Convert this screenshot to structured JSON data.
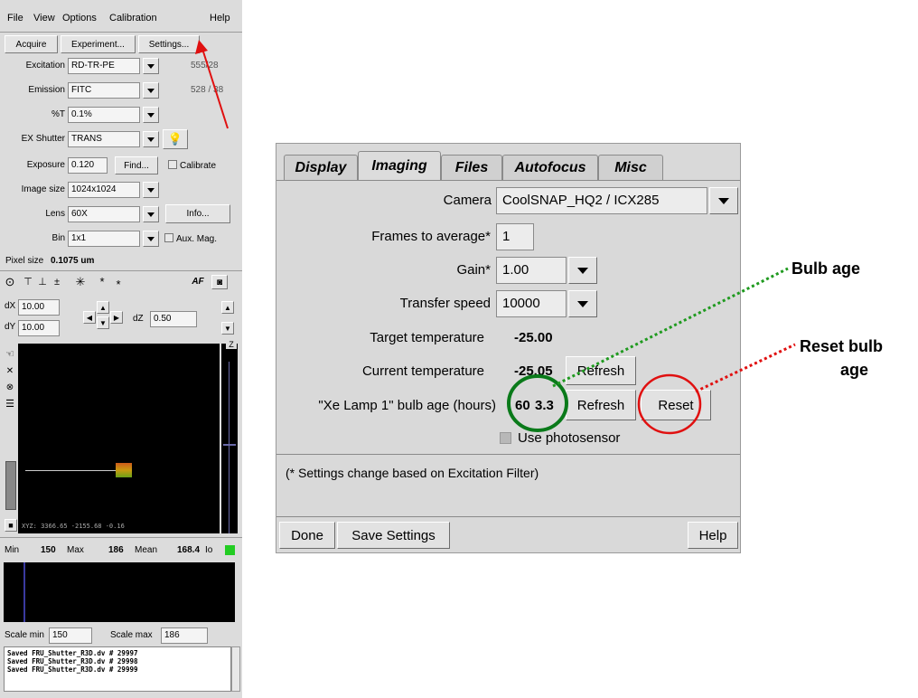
{
  "main_window": {
    "menu": [
      "File",
      "View",
      "Options",
      "Calibration",
      "Help"
    ],
    "toolbar": {
      "acquire": "Acquire",
      "experiment": "Experiment...",
      "settings": "Settings..."
    },
    "excitation": {
      "label": "Excitation",
      "value": "RD-TR-PE",
      "wavelength": "555/28"
    },
    "emission": {
      "label": "Emission",
      "value": "FITC",
      "wavelength": "528 / 38"
    },
    "transmission": {
      "label": "%T",
      "value": "0.1%"
    },
    "ex_shutter": {
      "label": "EX Shutter",
      "value": "TRANS"
    },
    "exposure": {
      "label": "Exposure",
      "value": "0.120",
      "find": "Find...",
      "calibrate": "Calibrate"
    },
    "image_size": {
      "label": "Image size",
      "value": "1024x1024"
    },
    "lens": {
      "label": "Lens",
      "value": "60X",
      "info": "Info..."
    },
    "bin": {
      "label": "Bin",
      "value": "1x1",
      "aux_mag": "Aux. Mag."
    },
    "pixel_size": {
      "label": "Pixel size",
      "value": "0.1075 um"
    },
    "af": "AF",
    "dx": {
      "label": "dX",
      "value": "10.00"
    },
    "dy": {
      "label": "dY",
      "value": "10.00"
    },
    "dz": {
      "label": "dZ",
      "value": "0.50"
    },
    "z_label": "Z",
    "xyz_readout": "XYZ: 3366.65 -2155.68 -0.16",
    "stats": {
      "min_label": "Min",
      "min": "150",
      "max_label": "Max",
      "max": "186",
      "mean_label": "Mean",
      "mean": "168.4",
      "suffix": "Io"
    },
    "scale": {
      "min_label": "Scale min",
      "min": "150",
      "max_label": "Scale max",
      "max": "186"
    },
    "log": [
      "Saved FRU_Shutter_R3D.dv # 29997",
      "Saved FRU_Shutter_R3D.dv # 29998",
      "Saved FRU_Shutter_R3D.dv # 29999"
    ]
  },
  "settings_dialog": {
    "tabs": [
      "Display",
      "Imaging",
      "Files",
      "Autofocus",
      "Misc"
    ],
    "active_tab": "Imaging",
    "camera": {
      "label": "Camera",
      "value": "CoolSNAP_HQ2 / ICX285"
    },
    "frames": {
      "label": "Frames to average*",
      "value": "1"
    },
    "gain": {
      "label": "Gain*",
      "value": "1.00"
    },
    "transfer_speed": {
      "label": "Transfer speed",
      "value": "10000"
    },
    "target_temp": {
      "label": "Target temperature",
      "value": "-25.00"
    },
    "current_temp": {
      "label": "Current temperature",
      "value": "-25.05",
      "refresh": "Refresh"
    },
    "bulb_age": {
      "label": "\"Xe Lamp 1\" bulb age (hours)",
      "value_a": "60",
      "value_b": "3.3",
      "refresh": "Refresh",
      "reset": "Reset"
    },
    "photosensor": "Use photosensor",
    "note": "(* Settings change based on Excitation Filter)",
    "footer": {
      "done": "Done",
      "save": "Save Settings",
      "help": "Help"
    }
  },
  "annotations": {
    "bulb_age": "Bulb age",
    "reset_line1": "Reset bulb",
    "reset_line2": "age"
  },
  "colors": {
    "green_circle": "#0a7a1a",
    "red_circle": "#e01010",
    "arrow_red": "#e01010",
    "stats_indicator": "#22cc22"
  }
}
